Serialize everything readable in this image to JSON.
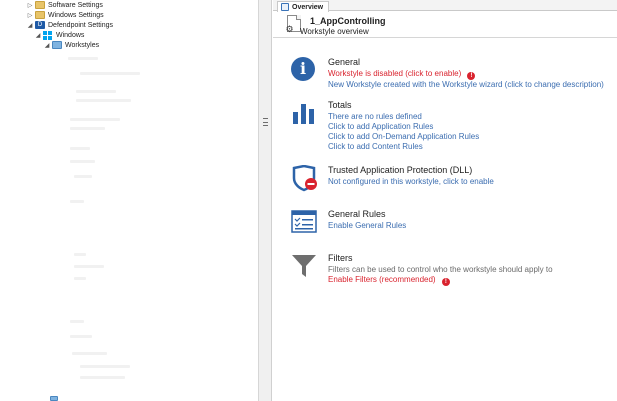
{
  "tree": {
    "items": [
      {
        "label": "Software Settings",
        "arrow": "▷",
        "icon": "folder-icon"
      },
      {
        "label": "Windows Settings",
        "arrow": "▷",
        "icon": "folder-icon"
      },
      {
        "label": "Defendpoint Settings",
        "arrow": "◢",
        "icon": "defendpoint-shield-icon"
      },
      {
        "label": "Windows",
        "arrow": "◢",
        "icon": "windows-logo-icon"
      },
      {
        "label": "Workstyles",
        "arrow": "◢",
        "icon": "folder-icon"
      }
    ],
    "shield_glyph": "D"
  },
  "tab": {
    "label": "Overview"
  },
  "header": {
    "workstyle_name": "1_AppControlling",
    "subtitle": "Workstyle overview",
    "gear_glyph": "⚙"
  },
  "sections": {
    "general": {
      "title": "General",
      "disabled_link": "Workstyle is disabled (click to enable)",
      "description_link": "New Workstyle created with the Workstyle wizard (click to change description)",
      "info_glyph": "i",
      "error_glyph": "!"
    },
    "totals": {
      "title": "Totals",
      "no_rules": "There are no rules defined",
      "add_app_rules": "Click to add Application Rules",
      "add_ondemand_rules": "Click to add On-Demand Application Rules",
      "add_content_rules": "Click to add Content Rules"
    },
    "tap": {
      "title": "Trusted Application Protection (DLL)",
      "status_link": "Not configured in this workstyle, click to enable"
    },
    "general_rules": {
      "title": "General Rules",
      "enable_link": "Enable General Rules"
    },
    "filters": {
      "title": "Filters",
      "description": "Filters can be used to control who the workstyle should apply to",
      "enable_link": "Enable Filters (recommended)",
      "error_glyph": "!"
    }
  },
  "colors": {
    "accent_blue": "#2d63a8",
    "link_blue": "#3b6db0",
    "warning_red": "#d9232e"
  }
}
